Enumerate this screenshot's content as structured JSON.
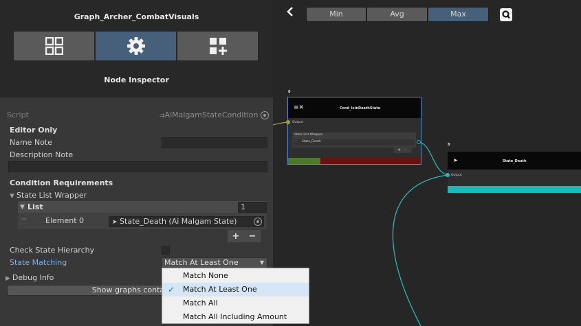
{
  "inspector": {
    "graph_title": "Graph_Archer_CombatVisuals",
    "tabs": [
      {
        "icon": "grid-four-icon"
      },
      {
        "icon": "gear-icon"
      },
      {
        "icon": "grid-add-icon"
      }
    ],
    "node_inspector_title": "Node Inspector",
    "script_label": "Script",
    "script_value": "AiMalgamStateCondition",
    "editor_only_label": "Editor Only",
    "name_note_label": "Name Note",
    "name_note_value": "",
    "description_note_label": "Description Note",
    "description_note_value": "",
    "condition_requirements_label": "Condition Requirements",
    "state_list_wrapper_label": "State List Wrapper",
    "list_label": "List",
    "list_count": "1",
    "element_label": "Element 0",
    "element_value": "State_Death (Ai Malgam State)",
    "plus_label": "+",
    "minus_label": "−",
    "check_state_hierarchy_label": "Check State Hierarchy",
    "check_state_hierarchy_checked": false,
    "state_matching_label": "State Matching",
    "state_matching_value": "Match At Least One",
    "debug_info_label": "Debug Info",
    "show_graphs_label": "Show graphs containing"
  },
  "dropdown_menu": {
    "items": [
      {
        "label": "Match None",
        "checked": false
      },
      {
        "label": "Match At Least One",
        "checked": true
      },
      {
        "label": "Match All",
        "checked": false
      },
      {
        "label": "Match All Including Amount",
        "checked": false
      }
    ]
  },
  "graph": {
    "segments": [
      {
        "label": "Min",
        "active": false
      },
      {
        "label": "Avg",
        "active": false
      },
      {
        "label": "Max",
        "active": true
      }
    ],
    "node_condition": {
      "index_label": "8",
      "title": "Cond_IsInDeathState",
      "output_label": "Output",
      "wrapper_label": "State List Wrapper",
      "state_label": "State_Death",
      "plus_label": "+",
      "minus_label": "-",
      "color_accent": "#5a8cc8",
      "bar_true_color": "#4d7a2a",
      "bar_false_color": "#6a1212"
    },
    "node_state": {
      "index_label": "8",
      "title": "State_Death",
      "output_label": "Output",
      "bar_color": "#1fb8b8"
    },
    "colors": {
      "connection_teal": "#2fb5b5",
      "connection_olive": "#9aa04a"
    }
  }
}
